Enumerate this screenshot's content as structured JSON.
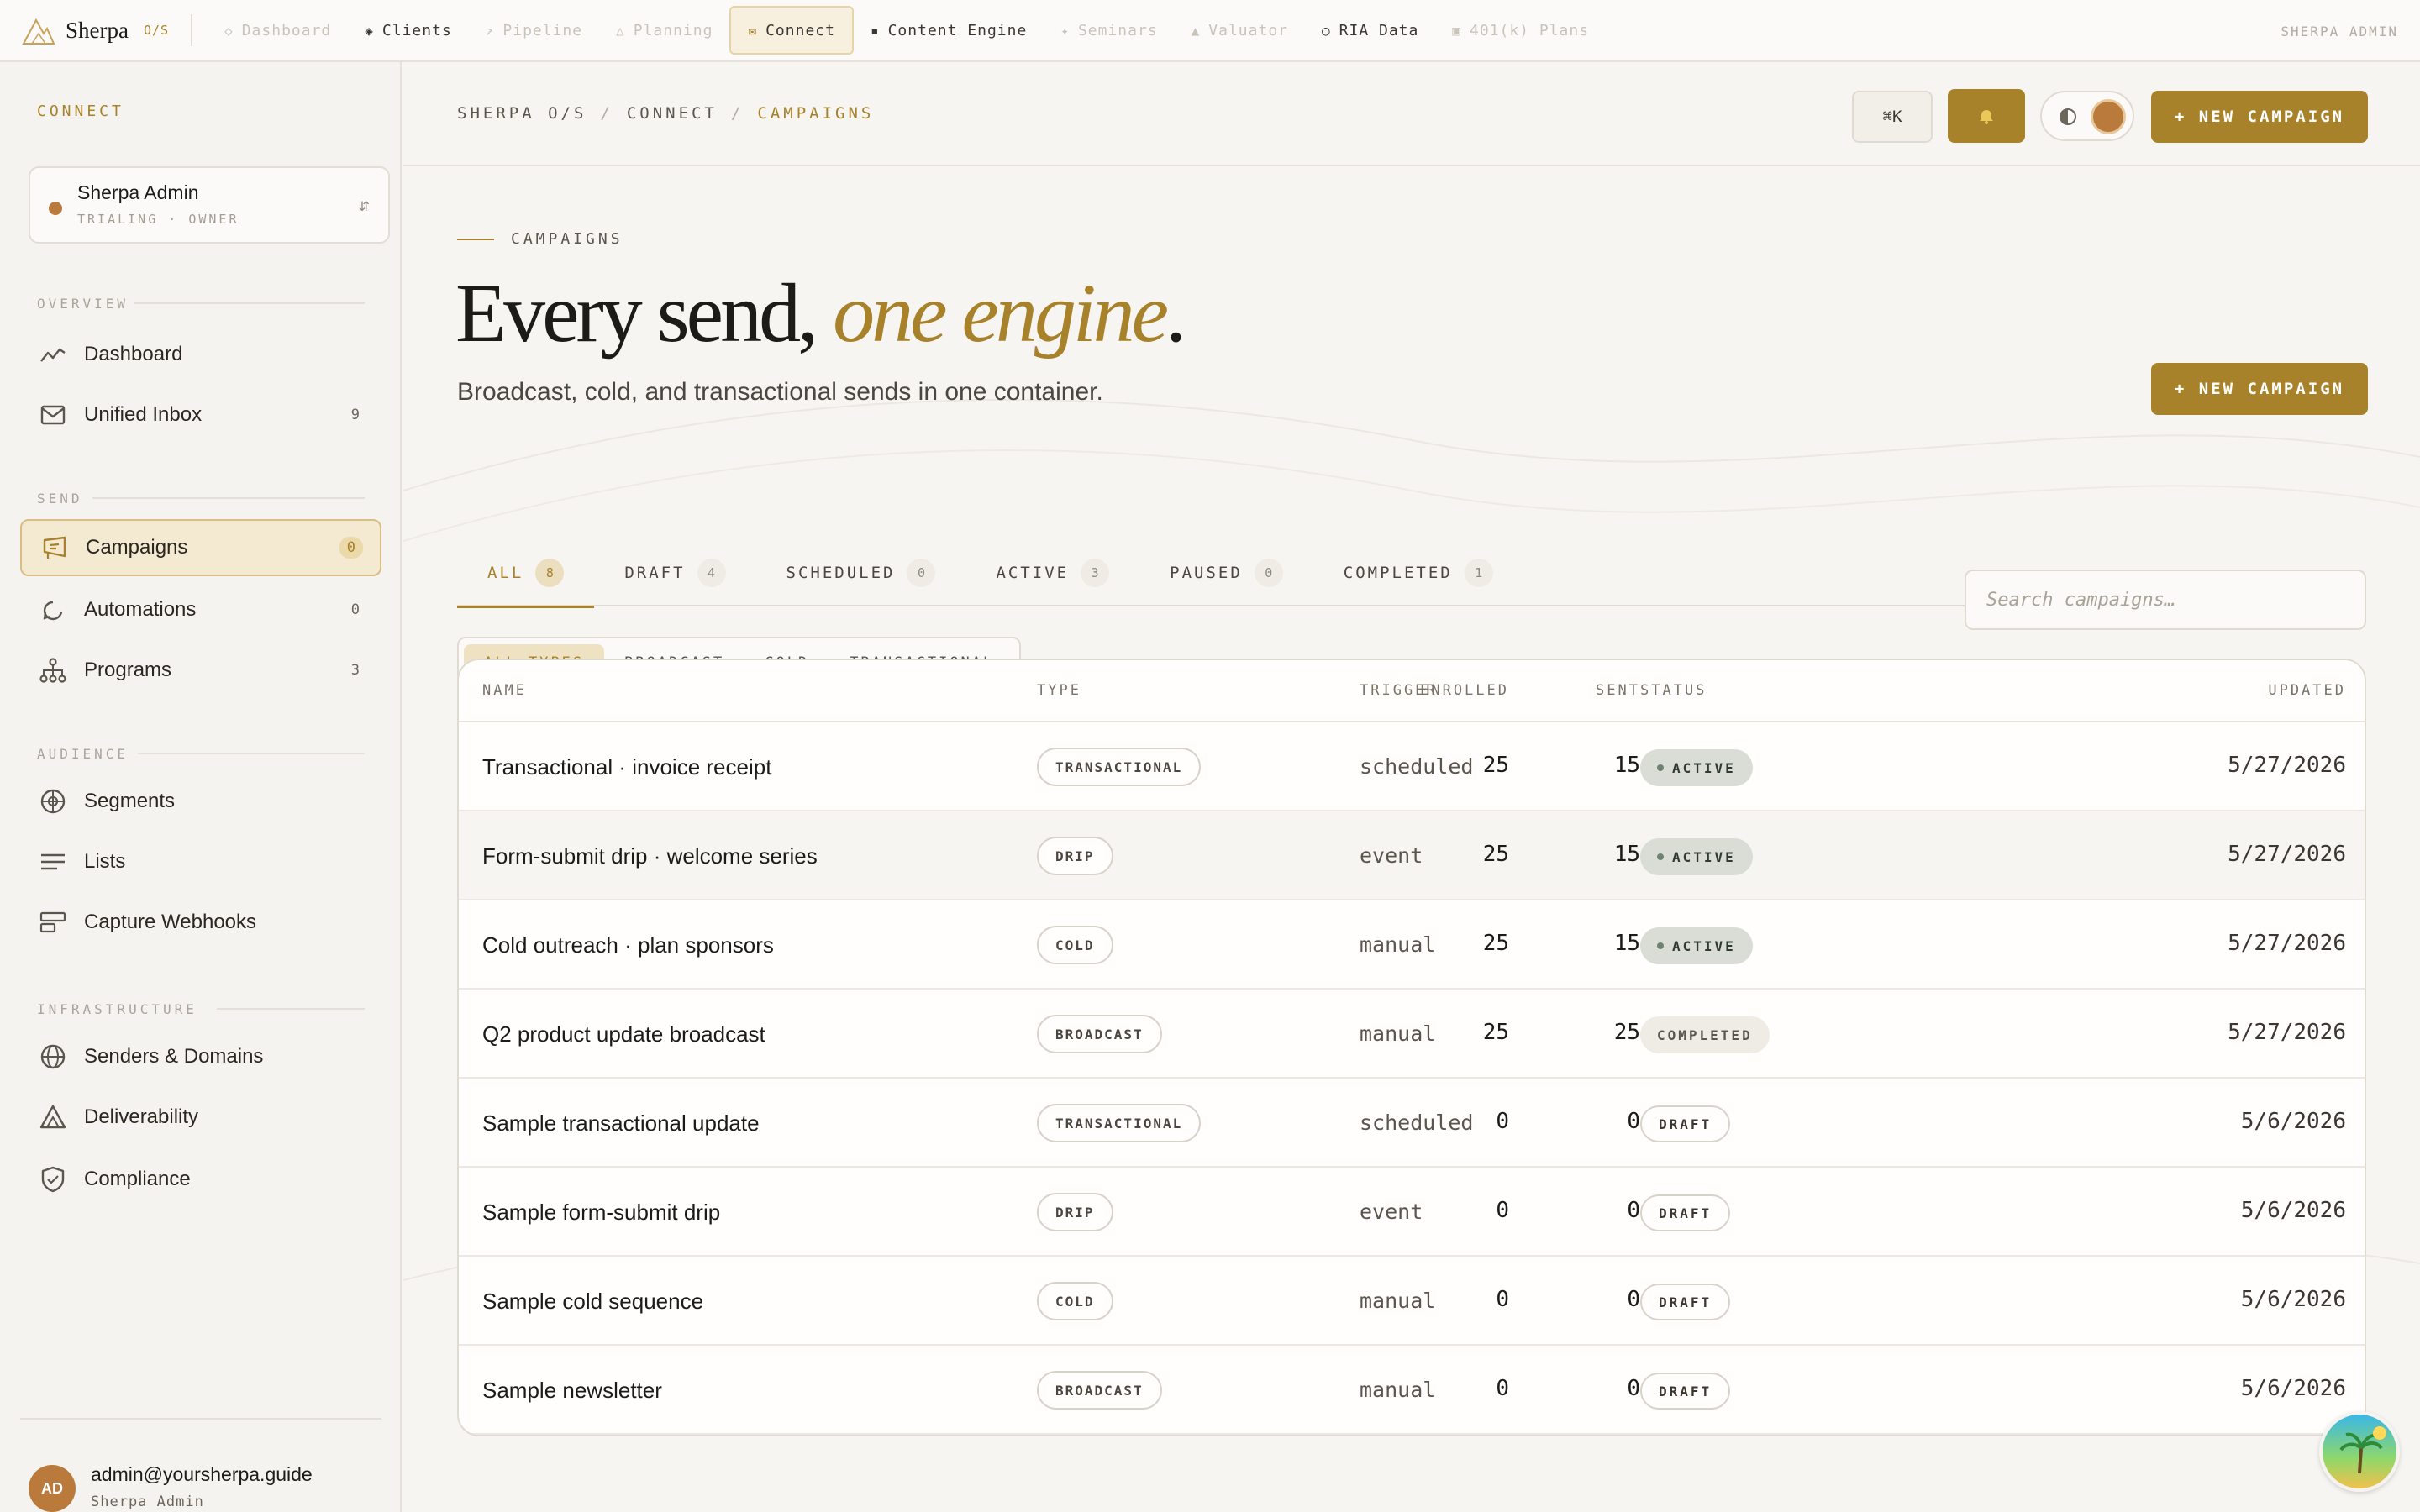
{
  "brand": {
    "name": "Sherpa",
    "tag": "O/S"
  },
  "topnav": {
    "items": [
      {
        "label": "Dashboard",
        "icon": "◇",
        "state": "dim"
      },
      {
        "label": "Clients",
        "icon": "◈",
        "state": "normal"
      },
      {
        "label": "Pipeline",
        "icon": "↗",
        "state": "dim"
      },
      {
        "label": "Planning",
        "icon": "△",
        "state": "dim"
      },
      {
        "label": "Connect",
        "icon": "✉",
        "state": "active"
      },
      {
        "label": "Content Engine",
        "icon": "▪",
        "state": "normal"
      },
      {
        "label": "Seminars",
        "icon": "✦",
        "state": "dim"
      },
      {
        "label": "Valuator",
        "icon": "▲",
        "state": "dim"
      },
      {
        "label": "RIA Data",
        "icon": "○",
        "state": "normal"
      },
      {
        "label": "401(k) Plans",
        "icon": "▣",
        "state": "dim"
      }
    ],
    "user": "SHERPA ADMIN"
  },
  "sidebar": {
    "title": "CONNECT",
    "workspace": {
      "name": "Sherpa Admin",
      "sub": "TRIALING · OWNER",
      "switch": "⇵"
    },
    "groups": {
      "overview": "OVERVIEW",
      "send": "SEND",
      "audience": "AUDIENCE",
      "infrastructure": "INFRASTRUCTURE"
    },
    "items": {
      "dashboard": {
        "label": "Dashboard",
        "icon": "trend-icon"
      },
      "inbox": {
        "label": "Unified Inbox",
        "count": "9",
        "icon": "mail-icon"
      },
      "campaigns": {
        "label": "Campaigns",
        "count": "0",
        "icon": "megaphone-icon"
      },
      "automations": {
        "label": "Automations",
        "count": "0",
        "icon": "loop-icon"
      },
      "programs": {
        "label": "Programs",
        "count": "3",
        "icon": "hierarchy-icon"
      },
      "segments": {
        "label": "Segments",
        "icon": "target-icon"
      },
      "lists": {
        "label": "Lists",
        "icon": "list-icon"
      },
      "webhooks": {
        "label": "Capture Webhooks",
        "icon": "webhook-icon"
      },
      "senders": {
        "label": "Senders & Domains",
        "icon": "globe-icon"
      },
      "deliverability": {
        "label": "Deliverability",
        "icon": "warning-icon"
      },
      "compliance": {
        "label": "Compliance",
        "icon": "shield-icon"
      }
    },
    "footer": {
      "initials": "AD",
      "email": "admin@yoursherpa.guide",
      "name": "Sherpa Admin"
    }
  },
  "header": {
    "breadcrumb": [
      "SHERPA O/S",
      "CONNECT",
      "CAMPAIGNS"
    ],
    "shortcut": "⌘K",
    "new_campaign": "+ NEW CAMPAIGN"
  },
  "hero": {
    "eyebrow": "CAMPAIGNS",
    "title_plain": "Every send, ",
    "title_accent": "one engine",
    "title_end": ".",
    "subtitle": "Broadcast, cold, and transactional sends in one container.",
    "cta": "+ NEW CAMPAIGN"
  },
  "tabs": [
    {
      "label": "ALL",
      "count": "8",
      "active": true
    },
    {
      "label": "DRAFT",
      "count": "4"
    },
    {
      "label": "SCHEDULED",
      "count": "0"
    },
    {
      "label": "ACTIVE",
      "count": "3"
    },
    {
      "label": "PAUSED",
      "count": "0"
    },
    {
      "label": "COMPLETED",
      "count": "1"
    }
  ],
  "filters": [
    "ALL TYPES",
    "BROADCAST",
    "COLD",
    "TRANSACTIONAL"
  ],
  "search": {
    "placeholder": "Search campaigns…"
  },
  "table": {
    "columns": {
      "name": "NAME",
      "type": "TYPE",
      "trigger": "TRIGGER",
      "status": "STATUS",
      "enrolled": "ENROLLED",
      "sent": "SENT",
      "updated": "UPDATED"
    },
    "rows": [
      {
        "name": "Transactional · invoice receipt",
        "type": "TRANSACTIONAL",
        "trigger": "scheduled",
        "status": "ACTIVE",
        "enrolled": "25",
        "sent": "15",
        "updated": "5/27/2026"
      },
      {
        "name": "Form-submit drip · welcome series",
        "type": "DRIP",
        "trigger": "event",
        "status": "ACTIVE",
        "enrolled": "25",
        "sent": "15",
        "updated": "5/27/2026"
      },
      {
        "name": "Cold outreach · plan sponsors",
        "type": "COLD",
        "trigger": "manual",
        "status": "ACTIVE",
        "enrolled": "25",
        "sent": "15",
        "updated": "5/27/2026"
      },
      {
        "name": "Q2 product update broadcast",
        "type": "BROADCAST",
        "trigger": "manual",
        "status": "COMPLETED",
        "enrolled": "25",
        "sent": "25",
        "updated": "5/27/2026"
      },
      {
        "name": "Sample transactional update",
        "type": "TRANSACTIONAL",
        "trigger": "scheduled",
        "status": "DRAFT",
        "enrolled": "0",
        "sent": "0",
        "updated": "5/6/2026"
      },
      {
        "name": "Sample form-submit drip",
        "type": "DRIP",
        "trigger": "event",
        "status": "DRAFT",
        "enrolled": "0",
        "sent": "0",
        "updated": "5/6/2026"
      },
      {
        "name": "Sample cold sequence",
        "type": "COLD",
        "trigger": "manual",
        "status": "DRAFT",
        "enrolled": "0",
        "sent": "0",
        "updated": "5/6/2026"
      },
      {
        "name": "Sample newsletter",
        "type": "BROADCAST",
        "trigger": "manual",
        "status": "DRAFT",
        "enrolled": "0",
        "sent": "0",
        "updated": "5/6/2026"
      }
    ]
  },
  "colors": {
    "accent": "#a7822a",
    "background": "#f7f5f1",
    "active_status": "#d9ddd5"
  }
}
